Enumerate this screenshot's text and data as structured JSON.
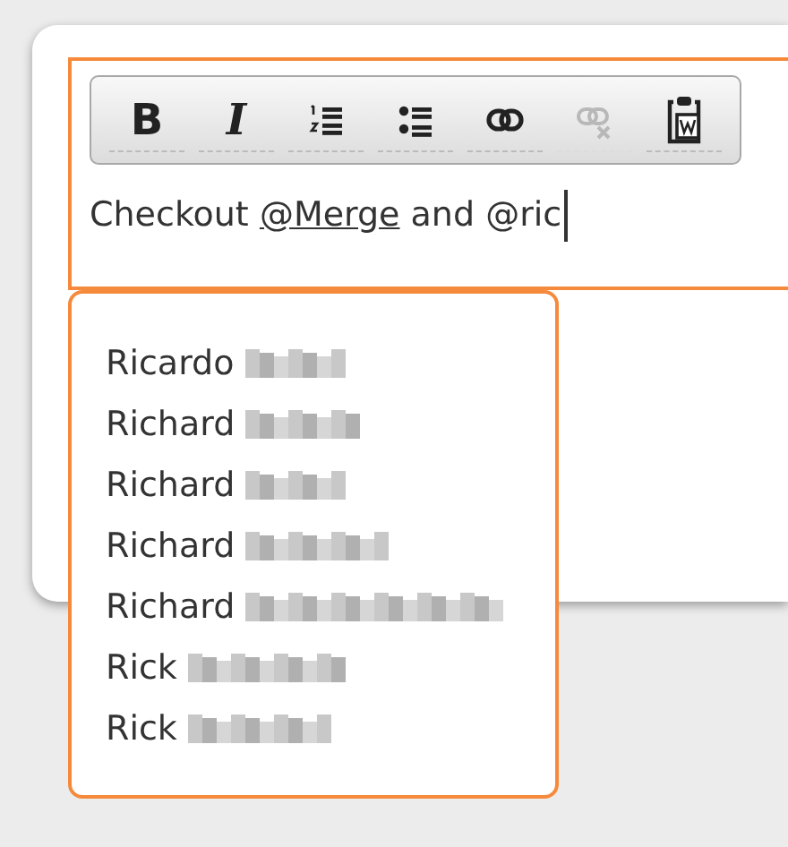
{
  "toolbar": [
    {
      "kind": "bold",
      "label": "B",
      "disabled": false
    },
    {
      "kind": "italic",
      "label": "I",
      "disabled": false
    },
    {
      "kind": "numbered-list",
      "disabled": false
    },
    {
      "kind": "bullet-list",
      "disabled": false
    },
    {
      "kind": "link",
      "disabled": false
    },
    {
      "kind": "unlink",
      "disabled": true
    },
    {
      "kind": "paste-word",
      "disabled": false
    }
  ],
  "editor": {
    "segments": [
      {
        "kind": "plain",
        "text": "Checkout "
      },
      {
        "kind": "mention",
        "text": "@Merge"
      },
      {
        "kind": "plain",
        "text": " and @ric"
      }
    ]
  },
  "suggestions": [
    {
      "first_name": "Ricardo",
      "selected": false
    },
    {
      "first_name": "Richard",
      "selected": false
    },
    {
      "first_name": "Richard",
      "selected": false
    },
    {
      "first_name": "Richard",
      "selected": false
    },
    {
      "first_name": "Richard",
      "selected": false
    },
    {
      "first_name": "Rick",
      "selected": false
    },
    {
      "first_name": "Rick",
      "selected": false
    }
  ]
}
